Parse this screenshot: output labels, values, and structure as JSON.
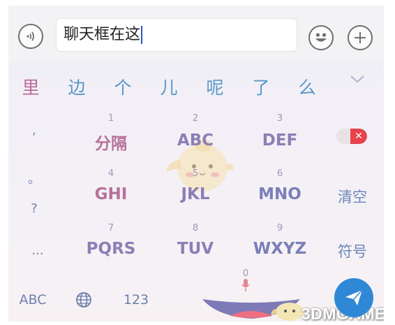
{
  "chat": {
    "input_text": "聊天框在这"
  },
  "candidates": [
    "里",
    "边",
    "个",
    "儿",
    "呢",
    "了",
    "么"
  ],
  "keys": {
    "row1": [
      {
        "num": "1",
        "label": "分隔"
      },
      {
        "num": "2",
        "label": "ABC"
      },
      {
        "num": "3",
        "label": "DEF"
      }
    ],
    "row2": [
      {
        "num": "4",
        "label": "GHI"
      },
      {
        "num": "5",
        "label": "JKL"
      },
      {
        "num": "6",
        "label": "MNO"
      }
    ],
    "row3": [
      {
        "num": "7",
        "label": "PQRS"
      },
      {
        "num": "8",
        "label": "TUV"
      },
      {
        "num": "9",
        "label": "WXYZ"
      }
    ],
    "punct": [
      ",",
      "。",
      "?",
      "..."
    ],
    "clear_label": "清空",
    "symbol_label": "符号",
    "space_num": "0"
  },
  "bottom": {
    "abc_label": "ABC",
    "num_label": "123"
  },
  "watermark": {
    "text": "3DMGAME"
  },
  "icons": {
    "voice": "voice-wave-icon",
    "emoji": "smiley-icon",
    "plus": "plus-icon",
    "collapse": "chevron-down-icon",
    "delete": "backspace-icon",
    "globe": "globe-icon",
    "mic": "microphone-icon",
    "send": "send-arrow-icon"
  },
  "colors": {
    "send": "#2f88d6",
    "delete": "#e7434b",
    "candidate": "#5a97c9",
    "candidate_first": "#b86b97"
  }
}
